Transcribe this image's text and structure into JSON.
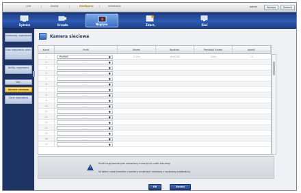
{
  "topnav": {
    "items": [
      "Live",
      "Szukaj",
      "Konfiguruj",
      "Informacje"
    ],
    "active_index": 2,
    "user": "admin",
    "buttons": [
      "Wyloguj",
      "Zamknij"
    ]
  },
  "menubar": {
    "tabs": [
      {
        "label": "System",
        "icon": "system-icon"
      },
      {
        "label": "Urządz.",
        "icon": "device-icon"
      },
      {
        "label": "Nagryw.",
        "icon": "record-icon"
      },
      {
        "label": "Zdarz.",
        "icon": "event-icon"
      },
      {
        "label": "Sieć",
        "icon": "network-icon"
      }
    ],
    "active_index": 2
  },
  "sidebar": {
    "items": [
      "Harmonog. nagrywania",
      "Czas nagrywania zdarz.",
      "Konfig. nagrywania",
      "Wył.",
      "Kamera sieciowa",
      "Opcje nagrywania"
    ],
    "active_index": 4
  },
  "page": {
    "title": "Kamera sieciowa"
  },
  "table": {
    "headers": [
      "Kanał",
      "Profil",
      "Kodek",
      "Rozdziel.",
      "Prędkość klatek",
      "Jakość"
    ],
    "rows": [
      {
        "ch": "1",
        "profile": "Profile2",
        "codec": "H.264",
        "res": "640X480",
        "fps": "30fps",
        "quality": "10"
      },
      {
        "ch": "2",
        "profile": "-",
        "codec": "-",
        "res": "-",
        "fps": "-",
        "quality": "-"
      },
      {
        "ch": "3",
        "profile": "-",
        "codec": "-",
        "res": "-",
        "fps": "-",
        "quality": "-"
      },
      {
        "ch": "4",
        "profile": "-",
        "codec": "-",
        "res": "-",
        "fps": "-",
        "quality": "-"
      },
      {
        "ch": "5",
        "profile": "-",
        "codec": "-",
        "res": "-",
        "fps": "-",
        "quality": "-"
      },
      {
        "ch": "6",
        "profile": "-",
        "codec": "-",
        "res": "-",
        "fps": "-",
        "quality": "-"
      },
      {
        "ch": "7",
        "profile": "-",
        "codec": "-",
        "res": "-",
        "fps": "-",
        "quality": "-"
      },
      {
        "ch": "8",
        "profile": "-",
        "codec": "-",
        "res": "-",
        "fps": "-",
        "quality": "-"
      },
      {
        "ch": "9",
        "profile": "-",
        "codec": "-",
        "res": "-",
        "fps": "-",
        "quality": "-"
      },
      {
        "ch": "10",
        "profile": "-",
        "codec": "-",
        "res": "-",
        "fps": "-",
        "quality": "-"
      },
      {
        "ch": "11",
        "profile": "-",
        "codec": "-",
        "res": "-",
        "fps": "-",
        "quality": "-"
      },
      {
        "ch": "12",
        "profile": "-",
        "codec": "-",
        "res": "-",
        "fps": "-",
        "quality": "-"
      },
      {
        "ch": "13",
        "profile": "-",
        "codec": "-",
        "res": "-",
        "fps": "-",
        "quality": "-"
      },
      {
        "ch": "14",
        "profile": "-",
        "codec": "-",
        "res": "-",
        "fps": "-",
        "quality": "-"
      },
      {
        "ch": "15",
        "profile": "-",
        "codec": "-",
        "res": "-",
        "fps": "-",
        "quality": "-"
      },
      {
        "ch": "16",
        "profile": "-",
        "codec": "-",
        "res": "-",
        "fps": "-",
        "quality": "-"
      },
      {
        "ch": "17",
        "profile": "-",
        "codec": "-",
        "res": "-",
        "fps": "-",
        "quality": "-"
      }
    ]
  },
  "notice": {
    "line1": "Profil nagrywania jest ustawiony inaczej niż profil sieciowy.",
    "line2": "W takim razie transfer z kamery może być mniejszy z wybraną prędkością."
  },
  "buttons": {
    "ok": "OK",
    "cancel": "Anuluj"
  }
}
